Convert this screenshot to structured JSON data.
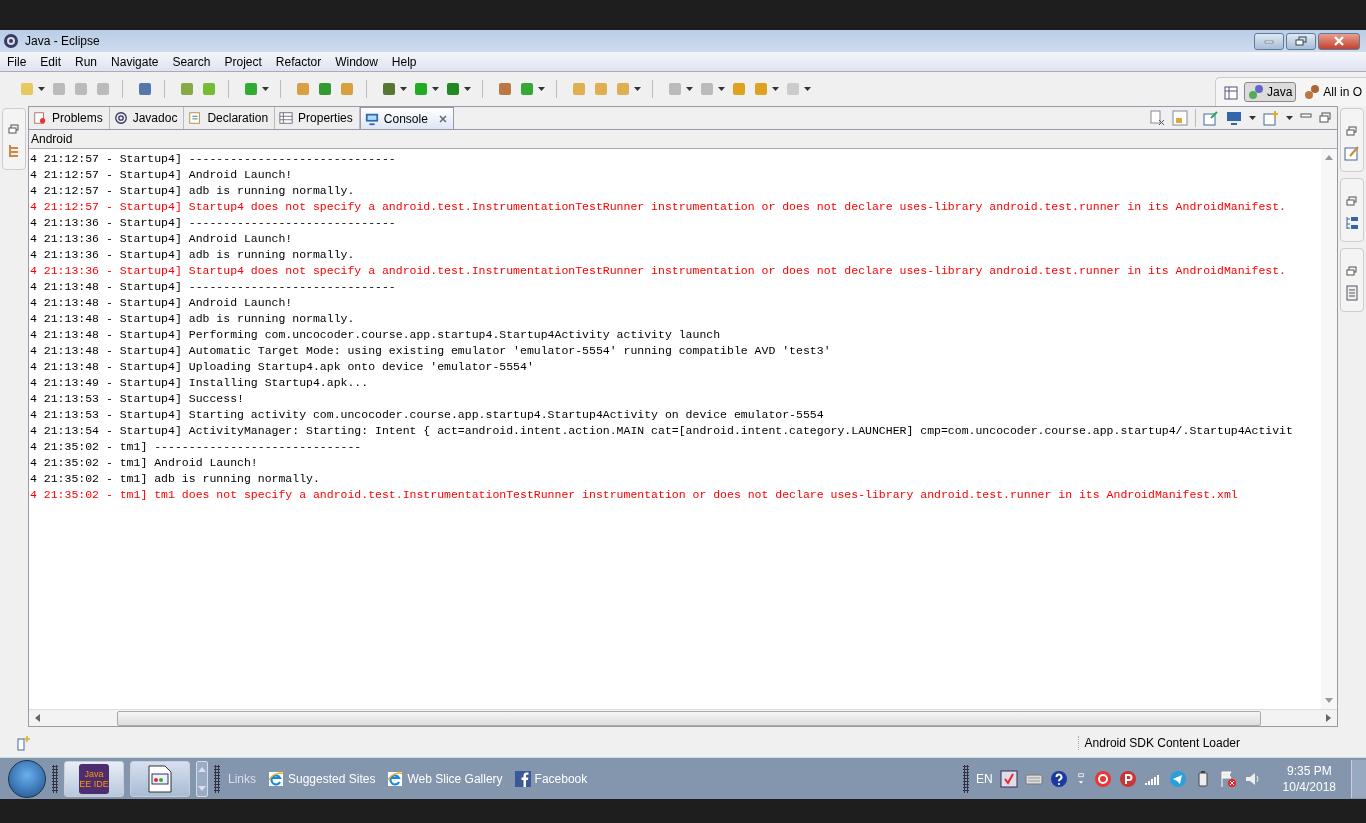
{
  "window": {
    "title": "Java - Eclipse"
  },
  "menu": [
    "File",
    "Edit",
    "Run",
    "Navigate",
    "Search",
    "Project",
    "Refactor",
    "Window",
    "Help"
  ],
  "perspectives": [
    {
      "label": "Java",
      "selected": true
    },
    {
      "label": "All in O",
      "selected": false
    }
  ],
  "tabs": [
    {
      "label": "Problems",
      "selected": false
    },
    {
      "label": "Javadoc",
      "selected": false
    },
    {
      "label": "Declaration",
      "selected": false
    },
    {
      "label": "Properties",
      "selected": false
    },
    {
      "label": "Console",
      "selected": true
    }
  ],
  "console": {
    "title": "Android",
    "lines": [
      {
        "kind": "info",
        "text": "4 21:12:57 - Startup4] ------------------------------"
      },
      {
        "kind": "info",
        "text": "4 21:12:57 - Startup4] Android Launch!"
      },
      {
        "kind": "info",
        "text": "4 21:12:57 - Startup4] adb is running normally."
      },
      {
        "kind": "error",
        "text": "4 21:12:57 - Startup4] Startup4 does not specify a android.test.InstrumentationTestRunner instrumentation or does not declare uses-library android.test.runner in its AndroidManifest."
      },
      {
        "kind": "info",
        "text": "4 21:13:36 - Startup4] ------------------------------"
      },
      {
        "kind": "info",
        "text": "4 21:13:36 - Startup4] Android Launch!"
      },
      {
        "kind": "info",
        "text": "4 21:13:36 - Startup4] adb is running normally."
      },
      {
        "kind": "error",
        "text": "4 21:13:36 - Startup4] Startup4 does not specify a android.test.InstrumentationTestRunner instrumentation or does not declare uses-library android.test.runner in its AndroidManifest."
      },
      {
        "kind": "info",
        "text": "4 21:13:48 - Startup4] ------------------------------"
      },
      {
        "kind": "info",
        "text": "4 21:13:48 - Startup4] Android Launch!"
      },
      {
        "kind": "info",
        "text": "4 21:13:48 - Startup4] adb is running normally."
      },
      {
        "kind": "info",
        "text": "4 21:13:48 - Startup4] Performing com.uncocoder.course.app.startup4.Startup4Activity activity launch"
      },
      {
        "kind": "info",
        "text": "4 21:13:48 - Startup4] Automatic Target Mode: using existing emulator 'emulator-5554' running compatible AVD 'test3'"
      },
      {
        "kind": "info",
        "text": "4 21:13:48 - Startup4] Uploading Startup4.apk onto device 'emulator-5554'"
      },
      {
        "kind": "info",
        "text": "4 21:13:49 - Startup4] Installing Startup4.apk..."
      },
      {
        "kind": "info",
        "text": "4 21:13:53 - Startup4] Success!"
      },
      {
        "kind": "info",
        "text": "4 21:13:53 - Startup4] Starting activity com.uncocoder.course.app.startup4.Startup4Activity on device emulator-5554"
      },
      {
        "kind": "info",
        "text": "4 21:13:54 - Startup4] ActivityManager: Starting: Intent { act=android.intent.action.MAIN cat=[android.intent.category.LAUNCHER] cmp=com.uncocoder.course.app.startup4/.Startup4Activit"
      },
      {
        "kind": "info",
        "text": "4 21:35:02 - tm1] ------------------------------"
      },
      {
        "kind": "info",
        "text": "4 21:35:02 - tm1] Android Launch!"
      },
      {
        "kind": "info",
        "text": "4 21:35:02 - tm1] adb is running normally."
      },
      {
        "kind": "error",
        "text": "4 21:35:02 - tm1] tm1 does not specify a android.test.InstrumentationTestRunner instrumentation or does not declare uses-library android.test.runner in its AndroidManifest.xml"
      }
    ]
  },
  "status_bar": {
    "text": "Android SDK Content Loader"
  },
  "taskbar": {
    "app_icon_label": "Java EE IDE",
    "links_label": "Links",
    "links": [
      "Suggested Sites",
      "Web Slice Gallery",
      "Facebook"
    ],
    "language": "EN",
    "time": "9:35 PM",
    "date": "10/4/2018"
  }
}
